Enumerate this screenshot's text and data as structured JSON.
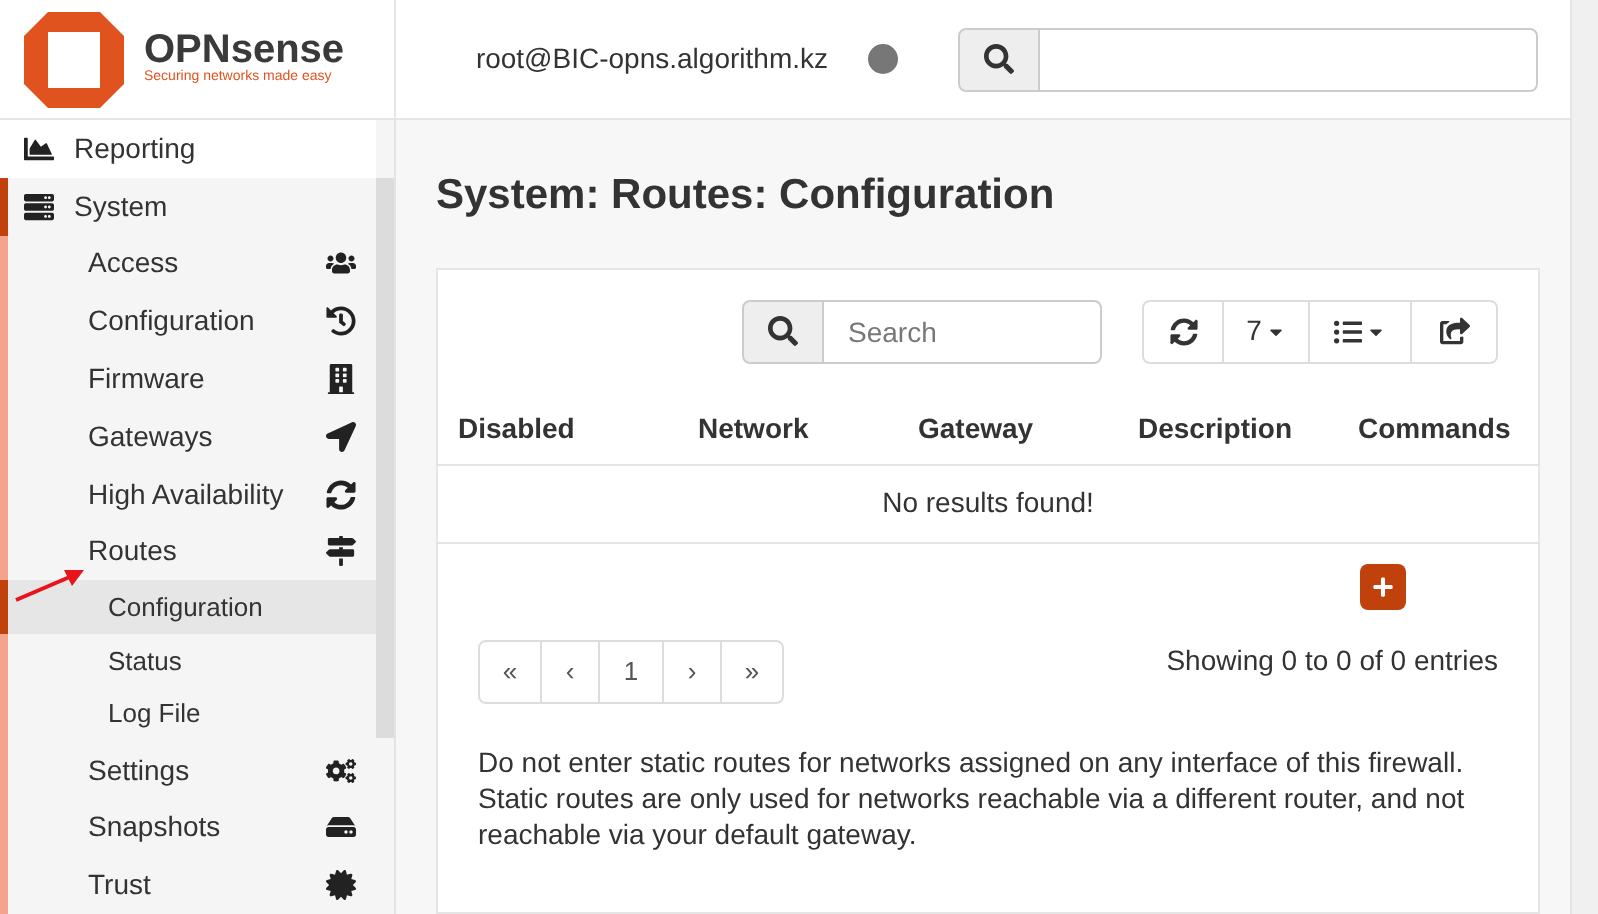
{
  "header": {
    "brand": "OPNsense",
    "tagline": "Securing networks made easy",
    "user": "root@BIC-opns.algorithm.kz"
  },
  "sidebar": {
    "items": [
      {
        "label": "Reporting",
        "selected": false,
        "expanded": false
      },
      {
        "label": "System",
        "selected": false,
        "expanded": true,
        "children": [
          {
            "label": "Access",
            "selected": false
          },
          {
            "label": "Configuration",
            "selected": false
          },
          {
            "label": "Firmware",
            "selected": false
          },
          {
            "label": "Gateways",
            "selected": false
          },
          {
            "label": "High Availability",
            "selected": false
          },
          {
            "label": "Routes",
            "selected": false,
            "expanded": true,
            "children": [
              {
                "label": "Configuration",
                "selected": true
              },
              {
                "label": "Status",
                "selected": false
              },
              {
                "label": "Log File",
                "selected": false
              }
            ]
          },
          {
            "label": "Settings",
            "selected": false
          },
          {
            "label": "Snapshots",
            "selected": false
          },
          {
            "label": "Trust",
            "selected": false
          }
        ]
      }
    ]
  },
  "page_title": "System: Routes: Configuration",
  "grid": {
    "search": {
      "placeholder": "Search"
    },
    "page_size": "7",
    "columns": [
      "Disabled",
      "Network",
      "Gateway",
      "Description",
      "Commands"
    ],
    "empty_message": "No results found!",
    "pagination": [
      "«",
      "‹",
      "1",
      "›",
      "»"
    ],
    "summary": "Showing 0 to 0 of 0 entries"
  },
  "note": "Do not enter static routes for networks assigned on any interface of this firewall. Static routes are only used for networks reachable via a different router, and not reachable via your default gateway."
}
